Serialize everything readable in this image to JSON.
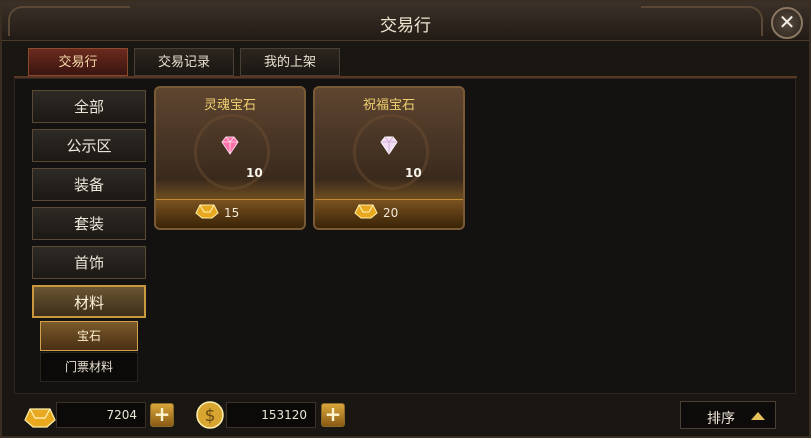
{
  "window": {
    "title": "交易行"
  },
  "tabs": [
    {
      "label": "交易行",
      "active": true
    },
    {
      "label": "交易记录",
      "active": false
    },
    {
      "label": "我的上架",
      "active": false
    }
  ],
  "sidebar": {
    "categories": [
      {
        "label": "全部",
        "active": false
      },
      {
        "label": "公示区",
        "active": false
      },
      {
        "label": "装备",
        "active": false
      },
      {
        "label": "套装",
        "active": false
      },
      {
        "label": "首饰",
        "active": false
      },
      {
        "label": "材料",
        "active": true
      }
    ],
    "subcategories": [
      {
        "label": "宝石",
        "active": true
      },
      {
        "label": "门票材料",
        "active": false
      }
    ]
  },
  "items": [
    {
      "name": "灵魂宝石",
      "quantity": "10",
      "price": "15",
      "icon": "pink-gem-icon",
      "gem_color": "#ff6fa8"
    },
    {
      "name": "祝福宝石",
      "quantity": "10",
      "price": "20",
      "icon": "white-gem-icon",
      "gem_color": "#f3dcf4"
    }
  ],
  "footer": {
    "gold": "7204",
    "silver": "153120",
    "sort_label": "排序"
  },
  "colors": {
    "accent": "#c9973d",
    "item_name": "#f0d070"
  }
}
